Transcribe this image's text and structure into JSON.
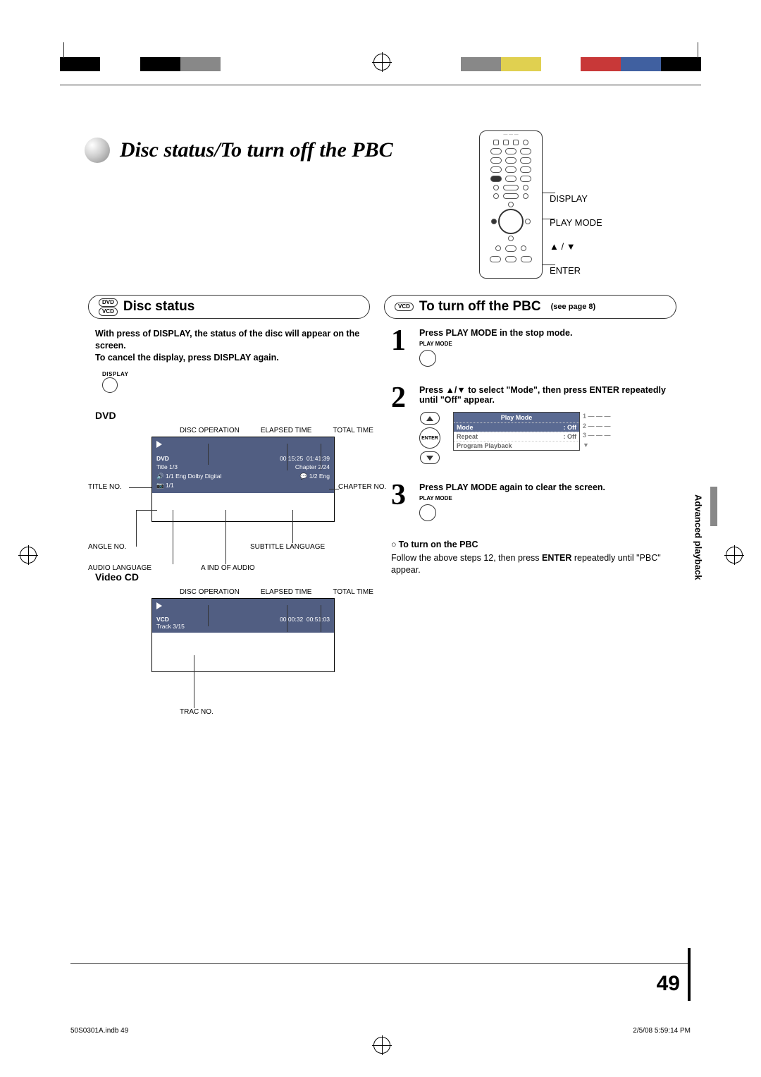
{
  "domain": "Document",
  "page_title": "Disc status/To turn off the PBC",
  "remote_labels": {
    "display": "DISPLAY",
    "play_mode": "PLAY MODE",
    "arrows": "▲ / ▼",
    "enter": "ENTER"
  },
  "sections": {
    "left": {
      "badge_top": "DVD",
      "badge_bottom": "VCD",
      "title": "Disc status"
    },
    "right": {
      "badge": "VCD",
      "title": "To turn off the PBC",
      "see_page": "(see page 8)"
    }
  },
  "left_col": {
    "intro_line1": "With press of DISPLAY, the status of the disc will appear on the screen.",
    "intro_line2": "To cancel the display, press DISPLAY again.",
    "display_btn": "DISPLAY",
    "dvd_head": "DVD",
    "labels": {
      "disc_operation": "DISC OPERATION",
      "elapsed_time": "ELAPSED TIME",
      "total_time": "TOTAL TIME",
      "title_no": "TITLE NO.",
      "chapter_no": "CHAPTER NO.",
      "angle_no": "ANGLE NO.",
      "subtitle_lang": "SUBTITLE LANGUAGE",
      "audio_lang": "AUDIO LANGUAGE",
      "kind_audio": "A IND OF AUDIO",
      "trac_no": "TRAC NO."
    },
    "dvd_osd": {
      "type_label": "DVD",
      "elapsed": "00:15:25",
      "total": "01:41:39",
      "title": "Title   1/3",
      "chapter": "Chapter 2/24",
      "audio": "1/1 Eng Dolby Digital",
      "subtitle": "1/2 Eng",
      "angle": "1/1"
    },
    "vcd_head": "Video CD",
    "vcd_osd": {
      "type_label": "VCD",
      "elapsed": "00:00:32",
      "total": "00:51:03",
      "track": "Track  3/15"
    }
  },
  "right_col": {
    "step1": {
      "num": "1",
      "text": "Press PLAY MODE in the stop mode.",
      "btn_label": "PLAY MODE"
    },
    "step2": {
      "num": "2",
      "text": "Press ▲/▼ to select \"Mode\", then press ENTER repeatedly until \"Off\" appear.",
      "enter_label": "ENTER",
      "osd": {
        "title": "Play Mode",
        "rows": [
          {
            "k": "Mode",
            "v": ": Off"
          },
          {
            "k": "Repeat",
            "v": ": Off"
          },
          {
            "k": "Program Playback",
            "v": ""
          }
        ],
        "side": [
          "1  — — —",
          "2  — — —",
          "3  — — —"
        ]
      }
    },
    "step3": {
      "num": "3",
      "text": "Press PLAY MODE again to clear the screen.",
      "btn_label": "PLAY MODE"
    },
    "turn_on_head": "To turn on the PBC",
    "turn_on_body_pre": "Follow the above steps 12, then press ",
    "turn_on_body_bold": "ENTER",
    "turn_on_body_post": " repeatedly until \"PBC\" appear."
  },
  "side_tab": "Advanced playback",
  "page_number": "49",
  "footer": {
    "left": "50S0301A.indb   49",
    "right": "2/5/08   5:59:14 PM"
  }
}
